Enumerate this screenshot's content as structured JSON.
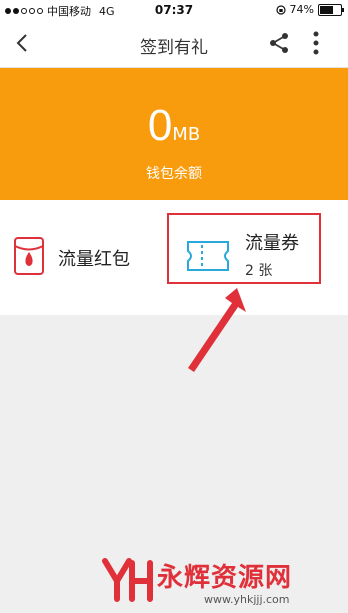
{
  "status_bar": {
    "carrier": "中国移动",
    "network": "4G",
    "time": "07:37",
    "battery": "74%",
    "battery_level": 0.74
  },
  "nav": {
    "title": "签到有礼"
  },
  "wallet": {
    "amount": "0",
    "unit": "MB",
    "label": "钱包余额",
    "color": "#f89c0e"
  },
  "cards": {
    "red_packet_label": "流量红包",
    "voucher_label": "流量券",
    "voucher_count": "2 张"
  },
  "watermark": {
    "title": "永辉资源网",
    "url": "www.yhkjjj.com"
  },
  "colors": {
    "accent": "#f89c0e",
    "highlight": "#e0313a",
    "voucher_icon": "#2aa8de"
  }
}
